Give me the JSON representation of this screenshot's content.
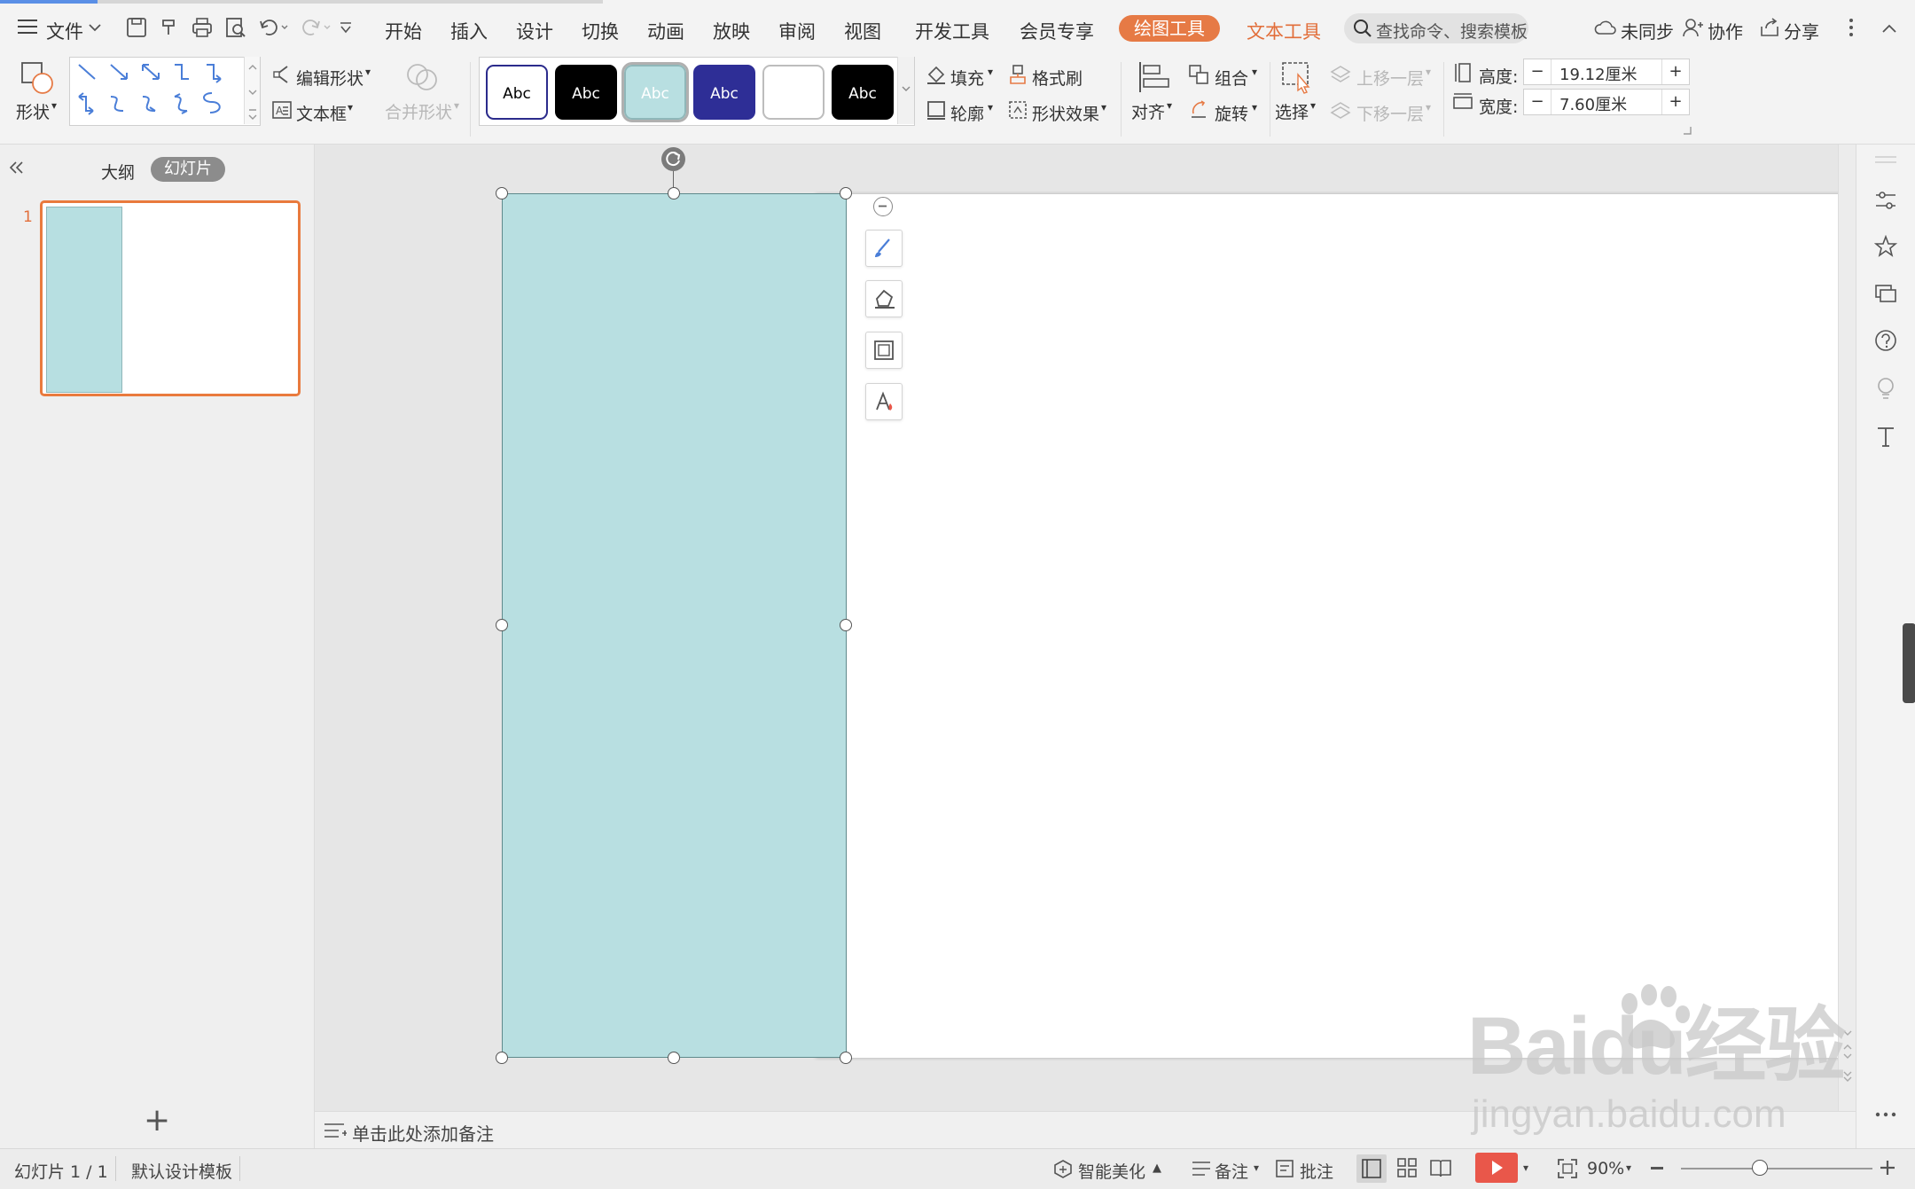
{
  "menubar": {
    "file": "文件",
    "tabs": [
      "开始",
      "插入",
      "设计",
      "切换",
      "动画",
      "放映",
      "审阅",
      "视图",
      "开发工具",
      "会员专享"
    ],
    "drawing_tools": "绘图工具",
    "text_tools": "文本工具",
    "search_placeholder": "查找命令、搜索模板",
    "sync": "未同步",
    "collab": "协作",
    "share": "分享"
  },
  "ribbon": {
    "shape": "形状",
    "edit_shape": "编辑形状",
    "text_box": "文本框",
    "merge_shape": "合并形状",
    "style_swatches": [
      {
        "text": "Abc",
        "bg": "#ffffff",
        "fg": "#000000",
        "border": "#2b2b8c"
      },
      {
        "text": "Abc",
        "bg": "#000000",
        "fg": "#ffffff",
        "border": "#000000"
      },
      {
        "text": "Abc",
        "bg": "#b8dfe1",
        "fg": "#ffffff",
        "border": "#8fb7b9"
      },
      {
        "text": "Abc",
        "bg": "#2e2e96",
        "fg": "#ffffff",
        "border": "#2e2e96"
      },
      {
        "text": "",
        "bg": "#ffffff",
        "fg": "#000000",
        "border": "#bdbdbd"
      },
      {
        "text": "Abc",
        "bg": "#000000",
        "fg": "#ffffff",
        "border": "#000000"
      }
    ],
    "fill": "填充",
    "format_painter": "格式刷",
    "outline": "轮廓",
    "shape_effects": "形状效果",
    "align": "对齐",
    "group": "组合",
    "rotate": "旋转",
    "select": "选择",
    "bring_forward": "上移一层",
    "send_backward": "下移一层",
    "height_label": "高度:",
    "height_value": "19.12厘米",
    "width_label": "宽度:",
    "width_value": "7.60厘米"
  },
  "left_panel": {
    "outline_tab": "大纲",
    "slides_tab": "幻灯片",
    "slide_number": "1",
    "add_slide": "+"
  },
  "notes": {
    "placeholder": "单击此处添加备注"
  },
  "statusbar": {
    "slide_info": "幻灯片 1 / 1",
    "template": "默认设计模板",
    "smart_beautify": "智能美化",
    "notes": "备注",
    "comments": "批注",
    "zoom": "90%"
  },
  "colors": {
    "accent": "#e67a45",
    "shape_fill": "#b8dfe1",
    "play": "#e9574a"
  },
  "watermark": {
    "logo": "Baidu经验",
    "url": "jingyan.baidu.com"
  }
}
